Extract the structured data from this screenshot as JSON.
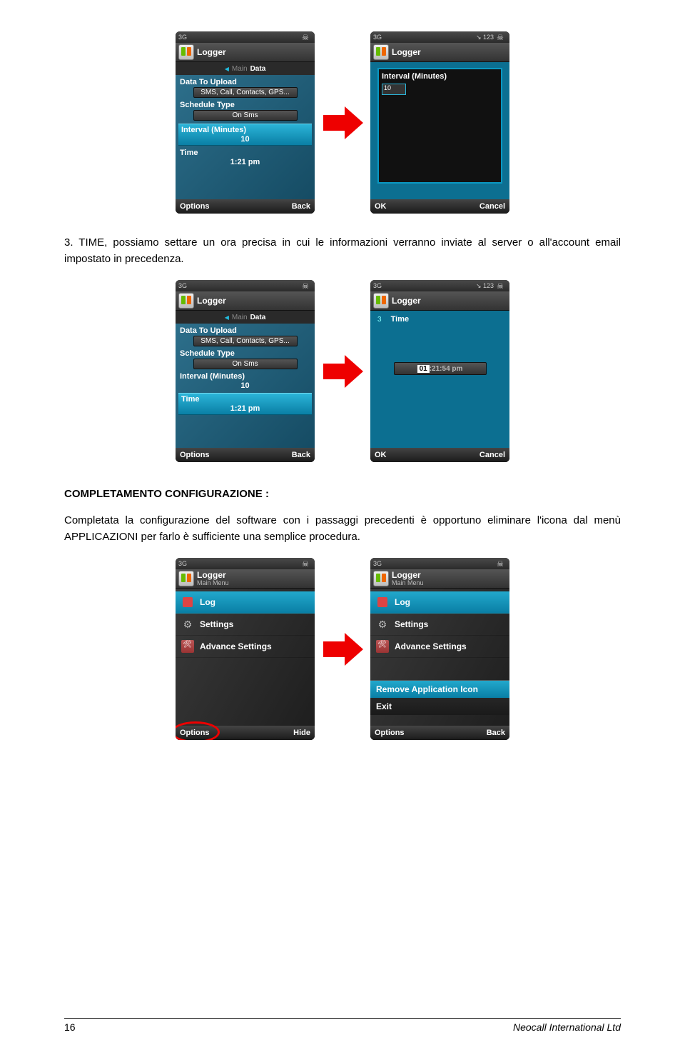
{
  "screens": {
    "a_left": {
      "statusbar_left": "3G",
      "app_title": "Logger",
      "tab_prefix": "Main",
      "tab_active": "Data",
      "fields": {
        "f1_label": "Data To Upload",
        "f1_value": "SMS, Call, Contacts, GPS...",
        "f2_label": "Schedule Type",
        "f2_value": "On Sms",
        "f3_label": "Interval (Minutes)",
        "f3_value": "10",
        "f4_label": "Time",
        "f4_value": "1:21 pm"
      },
      "sk_left": "Options",
      "sk_right": "Back"
    },
    "a_right": {
      "statusbar_left": "3G",
      "statusbar_right": "↘ 123",
      "app_title": "Logger",
      "editor_label": "Interval (Minutes)",
      "editor_value": "10",
      "sk_left": "OK",
      "sk_right": "Cancel"
    },
    "b_left": {
      "statusbar_left": "3G",
      "app_title": "Logger",
      "tab_prefix": "Main",
      "tab_active": "Data",
      "fields": {
        "f1_label": "Data To Upload",
        "f1_value": "SMS, Call, Contacts, GPS...",
        "f2_label": "Schedule Type",
        "f2_value": "On Sms",
        "f3_label": "Interval (Minutes)",
        "f3_value": "10",
        "f4_label": "Time",
        "f4_value": "1:21 pm"
      },
      "sk_left": "Options",
      "sk_right": "Back"
    },
    "b_right": {
      "statusbar_left": "3G",
      "statusbar_right": "↘ 123",
      "app_title": "Logger",
      "line_index": "3",
      "time_label": "Time",
      "time_sel": "01",
      "time_rest": ":21:54 pm",
      "sk_left": "OK",
      "sk_right": "Cancel"
    },
    "c_left": {
      "statusbar_left": "3G",
      "app_title": "Logger",
      "sub_title": "Main Menu",
      "items": {
        "i1": "Log",
        "i2": "Settings",
        "i3": "Advance Settings"
      },
      "sk_left": "Options",
      "sk_right": "Hide"
    },
    "c_right": {
      "statusbar_left": "3G",
      "app_title": "Logger",
      "sub_title": "Main Menu",
      "items": {
        "i1": "Log",
        "i2": "Settings",
        "i3": "Advance Settings"
      },
      "popup": {
        "p1": "Remove Application Icon",
        "p2": "Exit"
      },
      "sk_left": "Options",
      "sk_right": "Back"
    }
  },
  "doc": {
    "p1": "3. TIME, possiamo settare un ora precisa in cui le informazioni verranno inviate al server o all'account email impostato in precedenza.",
    "h1": "COMPLETAMENTO CONFIGURAZIONE :",
    "p2": "Completata la configurazione del software con i passaggi precedenti è opportuno eliminare l'icona dal menù APPLICAZIONI per farlo è sufficiente una semplice procedura.",
    "page_num": "16",
    "footer_right": "Neocall International Ltd"
  }
}
